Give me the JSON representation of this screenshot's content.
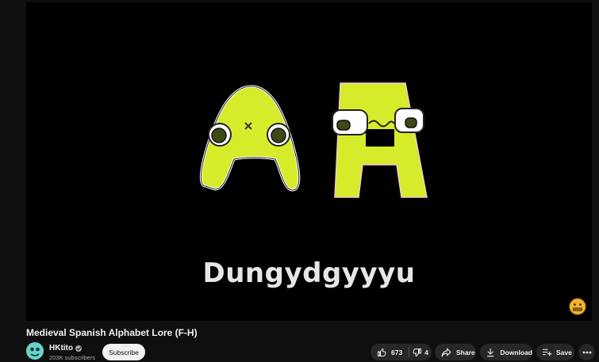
{
  "video": {
    "caption": "Dungydgyyyu",
    "title": "Medieval Spanish Alphabet Lore (F-H)"
  },
  "channel": {
    "name": "HKtito",
    "subscribers": "203K subscribers",
    "subscribe_label": "Subscribe"
  },
  "actions": {
    "like_count": "673",
    "dislike_count": "4",
    "share_label": "Share",
    "download_label": "Download",
    "save_label": "Save"
  },
  "colors": {
    "background": "#0f0f0f",
    "button_bg": "#272727",
    "letter_green": "#d6ec2a"
  }
}
